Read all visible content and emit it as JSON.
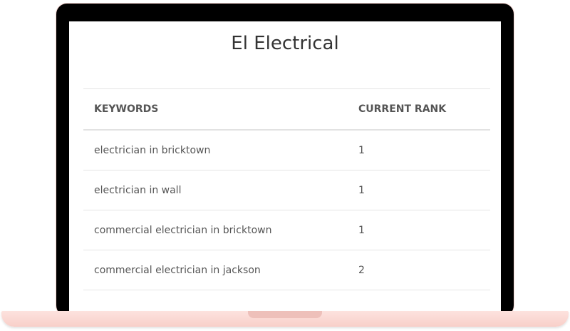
{
  "page": {
    "title": "El Electrical"
  },
  "table": {
    "headers": {
      "keywords": "KEYWORDS",
      "rank": "CURRENT RANK"
    },
    "rows": [
      {
        "keyword": "electrician in bricktown",
        "rank": "1"
      },
      {
        "keyword": "electrician in wall",
        "rank": "1"
      },
      {
        "keyword": "commercial electrician in bricktown",
        "rank": "1"
      },
      {
        "keyword": "commercial electrician in jackson",
        "rank": "2"
      }
    ]
  },
  "colors": {
    "bezel": "#000000",
    "laptop_base": "#fde2de",
    "screen_bg": "#ffffff",
    "text": "#555555"
  }
}
